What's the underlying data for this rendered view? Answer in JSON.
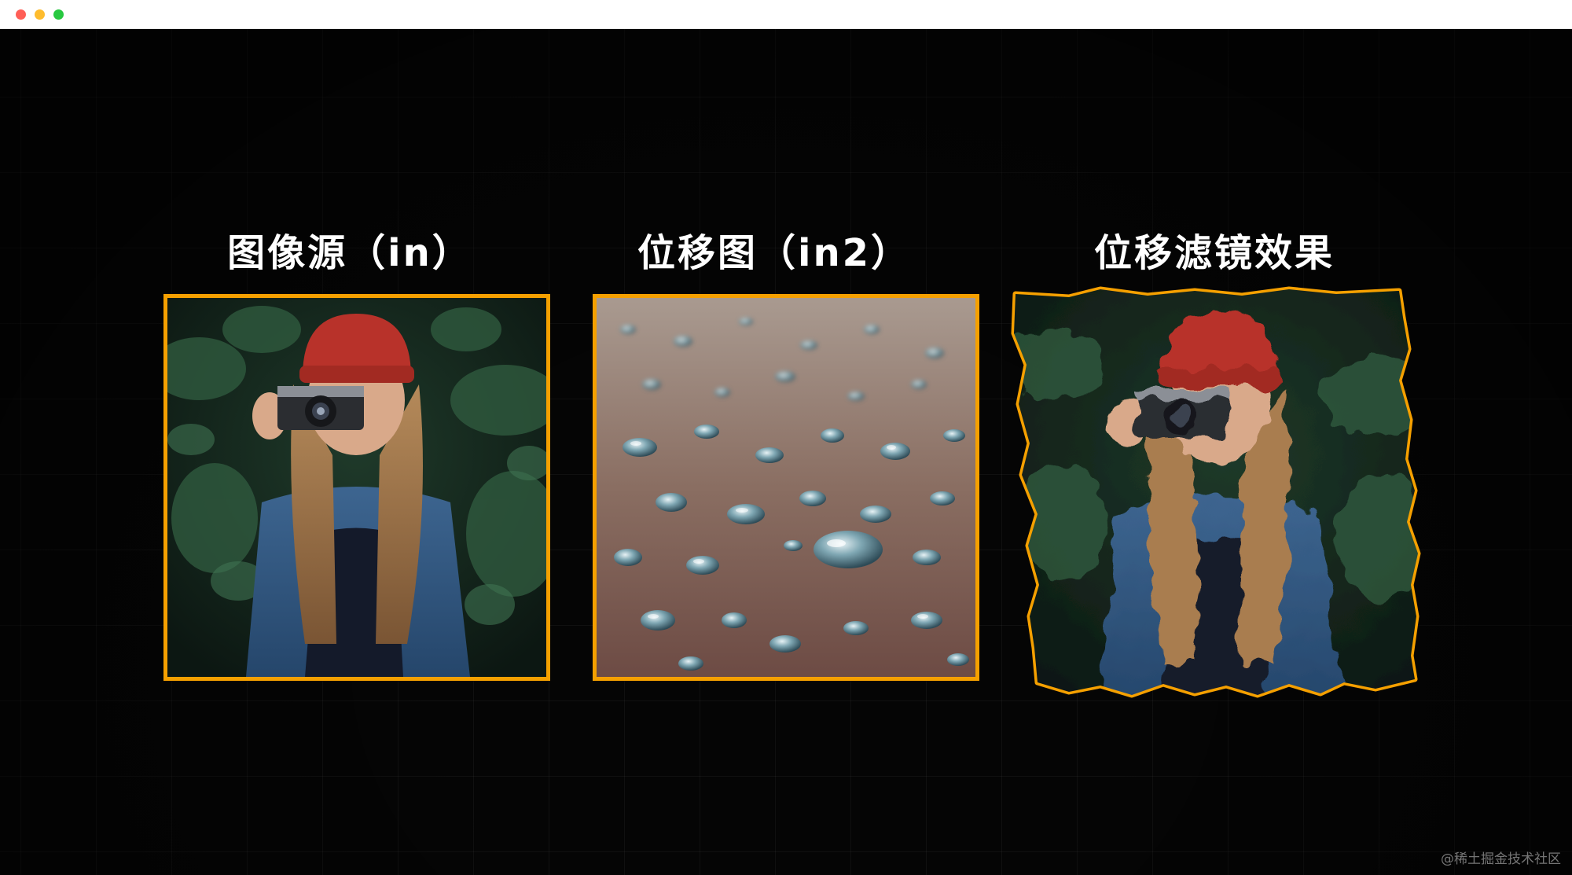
{
  "window": {
    "controls": [
      "close",
      "minimize",
      "zoom"
    ]
  },
  "panels": [
    {
      "title": "图像源（in）",
      "image": "woman-with-camera-photo"
    },
    {
      "title": "位移图（in2）",
      "image": "water-droplets-photo"
    },
    {
      "title": "位移滤镜效果",
      "image": "displaced-woman-with-camera-photo"
    }
  ],
  "watermark": "@稀土掘金技术社区",
  "colors": {
    "border": "#f5a000",
    "background": "#050505",
    "title_text": "#ffffff"
  }
}
